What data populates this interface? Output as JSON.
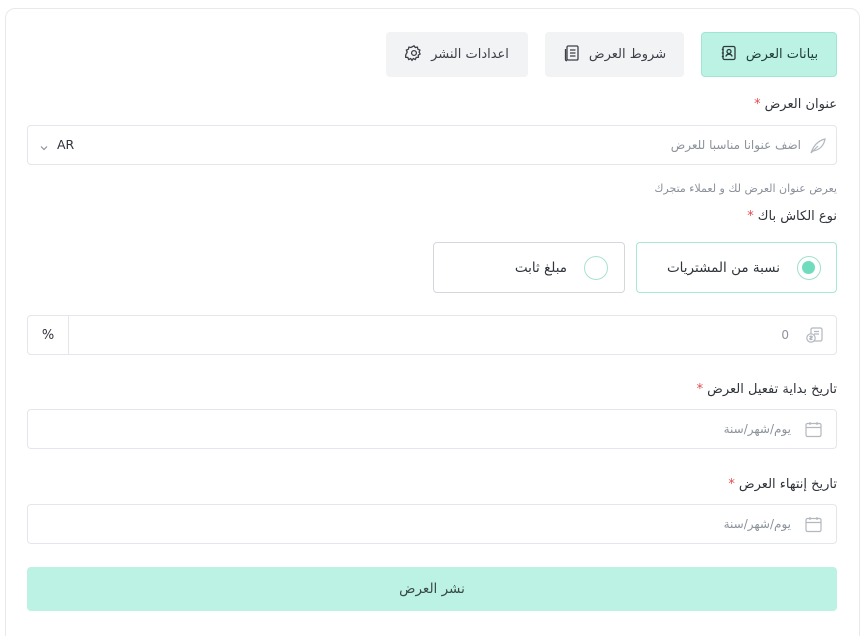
{
  "tabs": [
    {
      "label": "بيانات العرض",
      "icon": "contact-card-icon",
      "active": true
    },
    {
      "label": "شروط العرض",
      "icon": "document-list-icon",
      "active": false
    },
    {
      "label": "اعدادات النشر",
      "icon": "gear-icon",
      "active": false
    }
  ],
  "offer_title": {
    "label": "عنوان العرض",
    "required_mark": "*",
    "placeholder": "اضف عنوانا مناسبا للعرض",
    "language": "AR",
    "hint": "يعرض عنوان العرض لك و لعملاء متجرك"
  },
  "cashback_type": {
    "label": "نوع الكاش باك",
    "required_mark": "*",
    "options": [
      {
        "label": "نسبة من المشتريات",
        "selected": true
      },
      {
        "label": "مبلغ ثابت",
        "selected": false
      }
    ]
  },
  "amount": {
    "placeholder": "0",
    "unit": "%"
  },
  "start_date": {
    "label": "تاريخ بداية تفعيل العرض",
    "required_mark": "*",
    "placeholder": "يوم/شهر/سنة"
  },
  "end_date": {
    "label": "تاريخ إنتهاء العرض",
    "required_mark": "*",
    "placeholder": "يوم/شهر/سنة"
  },
  "publish_button": "نشر العرض",
  "colors": {
    "accent": "#bcf2e3",
    "radio_fill": "#6fdcbe",
    "required": "#e5484d"
  }
}
